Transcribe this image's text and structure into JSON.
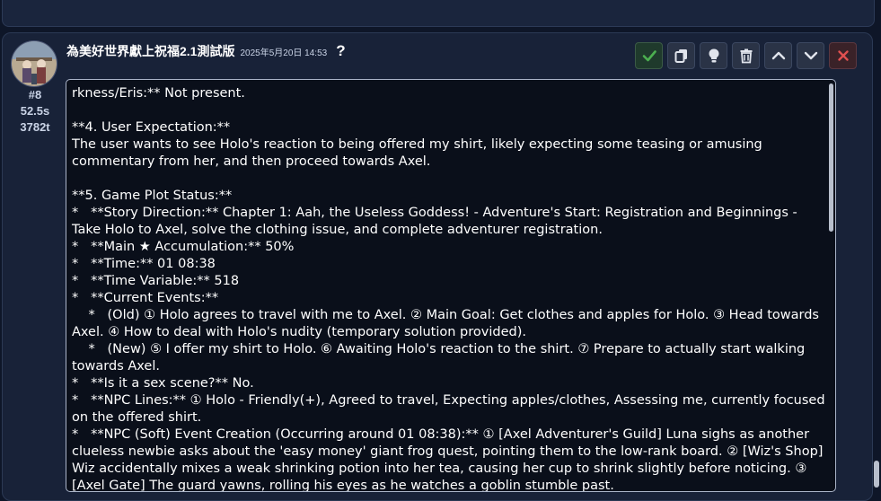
{
  "message": {
    "avatar": "character-avatar",
    "index": "#8",
    "duration": "52.5s",
    "tokens": "3782t",
    "character_name": "為美好世界獻上祝福2.1測試版",
    "timestamp": "2025年5月20日 14:53",
    "help_mark": "?",
    "toolbar": [
      {
        "name": "confirm-button",
        "icon": "check-icon",
        "color": "#4caf50"
      },
      {
        "name": "copy-button",
        "icon": "copy-icon",
        "color": "#e0e4ec"
      },
      {
        "name": "hint-button",
        "icon": "lightbulb-icon",
        "color": "#e0e4ec"
      },
      {
        "name": "delete-button",
        "icon": "trash-icon",
        "color": "#e0e4ec"
      },
      {
        "name": "move-up-button",
        "icon": "chevron-up-icon",
        "color": "#e0e4ec"
      },
      {
        "name": "move-down-button",
        "icon": "chevron-down-icon",
        "color": "#e0e4ec"
      },
      {
        "name": "cancel-button",
        "icon": "close-icon",
        "color": "#e05050"
      }
    ],
    "editor_text": "rkness/Eris:** Not present.\n\n**4. User Expectation:**\nThe user wants to see Holo's reaction to being offered my shirt, likely expecting some teasing or amusing commentary from her, and then proceed towards Axel.\n\n**5. Game Plot Status:**\n*   **Story Direction:** Chapter 1: Aah, the Useless Goddess! - Adventure's Start: Registration and Beginnings - Take Holo to Axel, solve the clothing issue, and complete adventurer registration.\n*   **Main ★ Accumulation:** 50%\n*   **Time:** 01 08:38\n*   **Time Variable:** 518\n*   **Current Events:**\n    *   (Old) ① Holo agrees to travel with me to Axel. ② Main Goal: Get clothes and apples for Holo. ③ Head towards Axel. ④ How to deal with Holo's nudity (temporary solution provided).\n    *   (New) ⑤ I offer my shirt to Holo. ⑥ Awaiting Holo's reaction to the shirt. ⑦ Prepare to actually start walking towards Axel.\n*   **Is it a sex scene?** No.\n*   **NPC Lines:** ① Holo - Friendly(+), Agreed to travel, Expecting apples/clothes, Assessing me, currently focused on the offered shirt.\n*   **NPC (Soft) Event Creation (Occurring around 01 08:38):** ① [Axel Adventurer's Guild] Luna sighs as another clueless newbie asks about the 'easy money' giant frog quest, pointing them to the low-rank board. ② [Wiz's Shop] Wiz accidentally mixes a weak shrinking potion into her tea, causing her cup to shrink slightly before noticing. ③ [Axel Gate] The guard yawns, rolling his eyes as he watches a goblin stumble past."
  }
}
